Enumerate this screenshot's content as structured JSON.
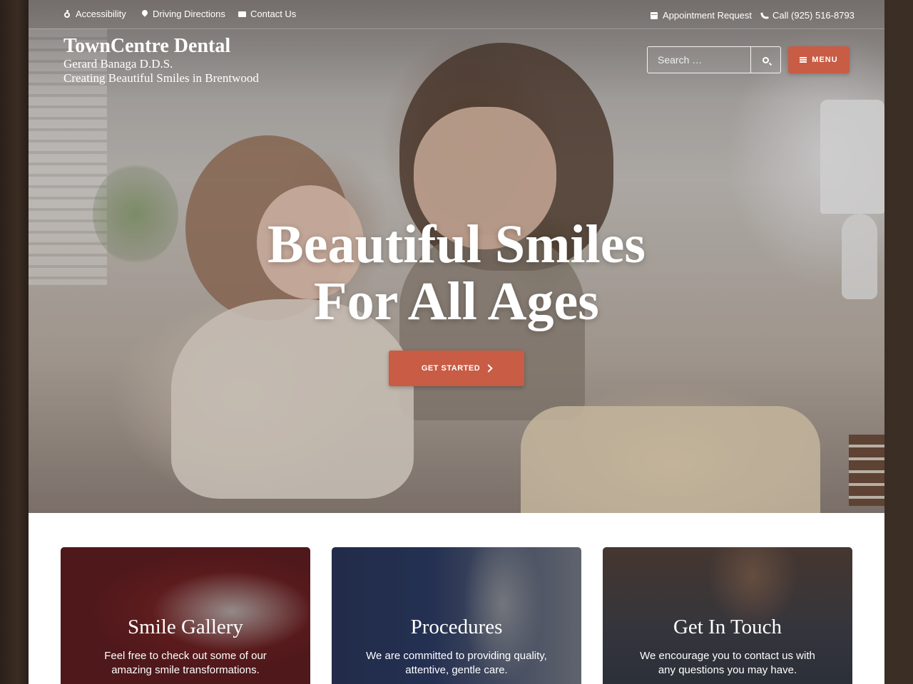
{
  "topbar": {
    "accessibility": "Accessibility",
    "directions": "Driving Directions",
    "contact": "Contact Us",
    "appointment": "Appointment Request",
    "phone": "Call (925) 516-8793"
  },
  "brand": {
    "name": "TownCentre Dental",
    "doctor": "Gerard Banaga D.D.S.",
    "tagline": "Creating Beautiful Smiles in Brentwood"
  },
  "search": {
    "placeholder": "Search …"
  },
  "menu": {
    "label": "MENU"
  },
  "hero": {
    "title_line1": "Beautiful Smiles",
    "title_line2": "For All Ages",
    "cta": "GET STARTED"
  },
  "cards": [
    {
      "title": "Smile Gallery",
      "desc": "Feel free to check out some of our amazing smile transformations."
    },
    {
      "title": "Procedures",
      "desc": "We are committed to providing quality, attentive, gentle care."
    },
    {
      "title": "Get In Touch",
      "desc": "We encourage you to contact us with any questions you may have."
    }
  ],
  "colors": {
    "accent": "#c85c45",
    "background": "#2f241d"
  },
  "icons": [
    "wheelchair-icon",
    "map-pin-icon",
    "envelope-icon",
    "calendar-icon",
    "phone-icon",
    "search-icon",
    "hamburger-icon",
    "arrow-right-icon"
  ]
}
